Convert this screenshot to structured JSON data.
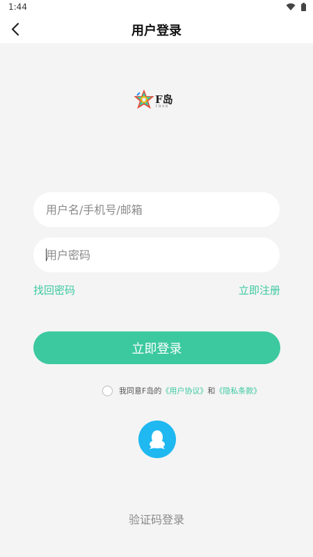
{
  "status_bar": {
    "time": "1:44",
    "icons": [
      "wifi-icon",
      "battery-icon"
    ]
  },
  "nav": {
    "title": "用户登录",
    "back_icon": "chevron-left-icon"
  },
  "logo": {
    "text": "F岛",
    "sub": "FDAO"
  },
  "form": {
    "username_placeholder": "用户名/手机号/邮箱",
    "password_placeholder": "用户密码",
    "forgot_label": "找回密码",
    "register_label": "立即注册",
    "login_label": "立即登录"
  },
  "agreement": {
    "prefix": "我同意F岛的",
    "user_agreement": "《用户协议》",
    "and": "和",
    "privacy_policy": "《隐私条款》"
  },
  "social": {
    "qq_icon": "qq-icon"
  },
  "alt_login": {
    "label": "验证码登录"
  },
  "colors": {
    "accent": "#3cc9a0",
    "qq": "#1fb8f0",
    "background": "#f4f4f4"
  }
}
